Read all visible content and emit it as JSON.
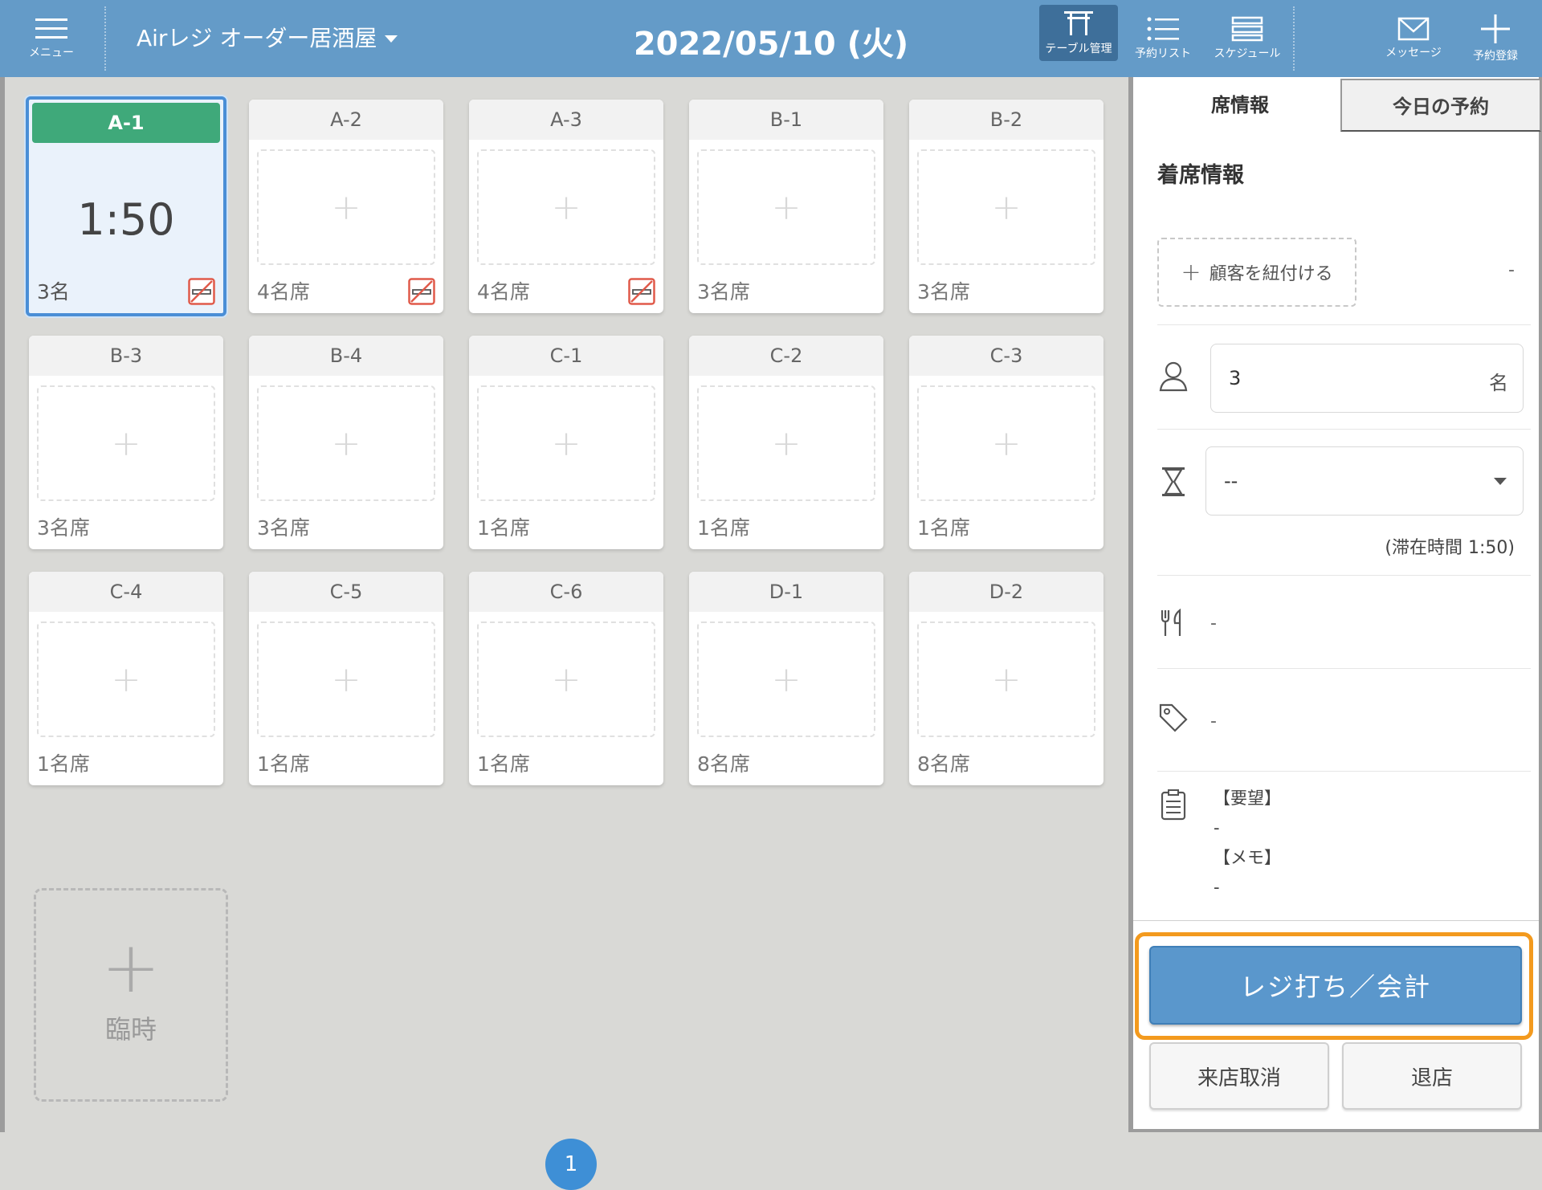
{
  "header": {
    "menu_label": "メニュー",
    "store_name": "Airレジ オーダー居酒屋",
    "date": "2022/05/10 (火)",
    "nav": {
      "table": "テーブル管理",
      "reservations": "予約リスト",
      "schedule": "スケジュール",
      "message": "メッセージ",
      "add_reservation": "予約登録"
    }
  },
  "tables": [
    {
      "name": "A-1",
      "seats": "3名",
      "time": "1:50",
      "active": true,
      "nosmoke": true
    },
    {
      "name": "A-2",
      "seats": "4名席",
      "nosmoke": true
    },
    {
      "name": "A-3",
      "seats": "4名席",
      "nosmoke": true
    },
    {
      "name": "B-1",
      "seats": "3名席"
    },
    {
      "name": "B-2",
      "seats": "3名席"
    },
    {
      "name": "B-3",
      "seats": "3名席"
    },
    {
      "name": "B-4",
      "seats": "3名席"
    },
    {
      "name": "C-1",
      "seats": "1名席"
    },
    {
      "name": "C-2",
      "seats": "1名席"
    },
    {
      "name": "C-3",
      "seats": "1名席"
    },
    {
      "name": "C-4",
      "seats": "1名席"
    },
    {
      "name": "C-5",
      "seats": "1名席"
    },
    {
      "name": "C-6",
      "seats": "1名席"
    },
    {
      "name": "D-1",
      "seats": "8名席"
    },
    {
      "name": "D-2",
      "seats": "8名席"
    }
  ],
  "temp_table": {
    "plus": "+",
    "label": "臨時"
  },
  "pagination": {
    "current": "1"
  },
  "panel": {
    "tabs": {
      "seat_info": "席情報",
      "today_reservations": "今日の予約"
    },
    "section_title": "着席情報",
    "link_customer": "顧客を紐付ける",
    "link_customer_plus": "+",
    "customer_value": "-",
    "guests": {
      "value": "3",
      "unit": "名"
    },
    "duration": {
      "value": "--"
    },
    "stay_time": "(滞在時間 1:50)",
    "course": "-",
    "tag": "-",
    "memo": {
      "request_label": "【要望】",
      "request_value": "-",
      "memo_label": "【メモ】",
      "memo_value": "-"
    },
    "buttons": {
      "checkout": "レジ打ち／会計",
      "cancel_visit": "来店取消",
      "leave": "退店"
    }
  },
  "colors": {
    "header": "#649bc8",
    "active_green": "#3fa97a",
    "active_border": "#4a8ed6",
    "highlight": "#f39a1e",
    "primary_button": "#5a97cc"
  }
}
